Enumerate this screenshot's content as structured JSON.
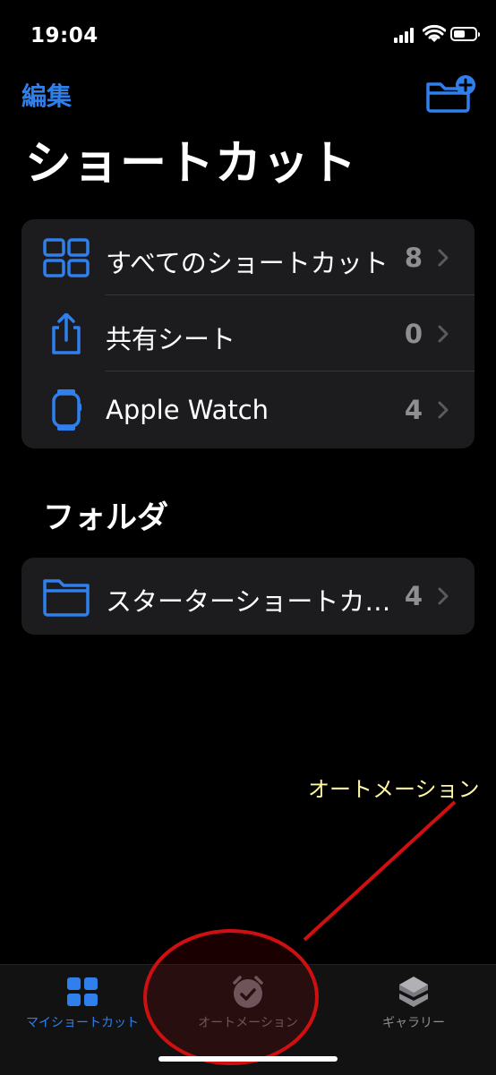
{
  "status_bar": {
    "time": "19:04"
  },
  "nav": {
    "edit_label": "編集",
    "new_folder_icon": "folder-plus-icon"
  },
  "page_title": "ショートカット",
  "main_list": [
    {
      "icon": "grid-icon",
      "label": "すべてのショートカット",
      "count": "8"
    },
    {
      "icon": "share-icon",
      "label": "共有シート",
      "count": "0"
    },
    {
      "icon": "watch-icon",
      "label": "Apple Watch",
      "count": "4"
    }
  ],
  "folders": {
    "header": "フォルダ",
    "items": [
      {
        "icon": "folder-icon",
        "label": "スターターショートカ…",
        "count": "4"
      }
    ]
  },
  "annotation": {
    "label": "オートメーション",
    "color": "#d01010",
    "text_color": "#fff6a6"
  },
  "tab_bar": {
    "tabs": [
      {
        "label": "マイショートカット",
        "icon": "grid-icon",
        "selected": true
      },
      {
        "label": "オートメーション",
        "icon": "clock-check-icon",
        "selected": false
      },
      {
        "label": "ギャラリー",
        "icon": "layers-icon",
        "selected": false
      }
    ]
  },
  "colors": {
    "accent": "#2f80ed",
    "background": "#000000",
    "card": "#1c1c1e",
    "secondary_text": "#8e8e93"
  }
}
